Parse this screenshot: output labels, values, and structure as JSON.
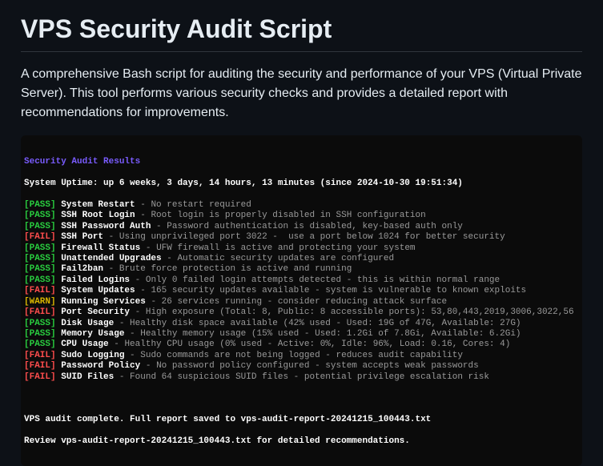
{
  "title": "VPS Security Audit Script",
  "description": "A comprehensive Bash script for auditing the security and performance of your VPS (Virtual Private Server). This tool performs various security checks and provides a detailed report with recommendations for improvements.",
  "terminal": {
    "header": "Security Audit Results",
    "uptime_label": "System Uptime:",
    "uptime_value": "up 6 weeks, 3 days, 14 hours, 13 minutes (since 2024-10-30 19:51:34)",
    "footer1": "VPS audit complete. Full report saved to vps-audit-report-20241215_100443.txt",
    "footer2": "Review vps-audit-report-20241215_100443.txt for detailed recommendations."
  },
  "results": [
    {
      "status": "PASS",
      "name": "System Restart",
      "msg": "No restart required"
    },
    {
      "status": "PASS",
      "name": "SSH Root Login",
      "msg": "Root login is properly disabled in SSH configuration"
    },
    {
      "status": "PASS",
      "name": "SSH Password Auth",
      "msg": "Password authentication is disabled, key-based auth only"
    },
    {
      "status": "FAIL",
      "name": "SSH Port",
      "msg": "Using unprivileged port 3022 -  use a port below 1024 for better security"
    },
    {
      "status": "PASS",
      "name": "Firewall Status",
      "msg": "UFW firewall is active and protecting your system"
    },
    {
      "status": "PASS",
      "name": "Unattended Upgrades",
      "msg": "Automatic security updates are configured"
    },
    {
      "status": "PASS",
      "name": "Fail2ban",
      "msg": "Brute force protection is active and running"
    },
    {
      "status": "PASS",
      "name": "Failed Logins",
      "msg": "Only 0 failed login attempts detected - this is within normal range"
    },
    {
      "status": "FAIL",
      "name": "System Updates",
      "msg": "165 security updates available - system is vulnerable to known exploits"
    },
    {
      "status": "WARN",
      "name": "Running Services",
      "msg": "26 services running - consider reducing attack surface"
    },
    {
      "status": "FAIL",
      "name": "Port Security",
      "msg": "High exposure (Total: 8, Public: 8 accessible ports): 53,80,443,2019,3006,3022,56"
    },
    {
      "status": "PASS",
      "name": "Disk Usage",
      "msg": "Healthy disk space available (42% used - Used: 19G of 47G, Available: 27G)"
    },
    {
      "status": "PASS",
      "name": "Memory Usage",
      "msg": "Healthy memory usage (15% used - Used: 1.2Gi of 7.8Gi, Available: 6.2Gi)"
    },
    {
      "status": "PASS",
      "name": "CPU Usage",
      "msg": "Healthy CPU usage (0% used - Active: 0%, Idle: 96%, Load: 0.16, Cores: 4)"
    },
    {
      "status": "FAIL",
      "name": "Sudo Logging",
      "msg": "Sudo commands are not being logged - reduces audit capability"
    },
    {
      "status": "FAIL",
      "name": "Password Policy",
      "msg": "No password policy configured - system accepts weak passwords"
    },
    {
      "status": "FAIL",
      "name": "SUID Files",
      "msg": "Found 64 suspicious SUID files - potential privilege escalation risk"
    }
  ]
}
